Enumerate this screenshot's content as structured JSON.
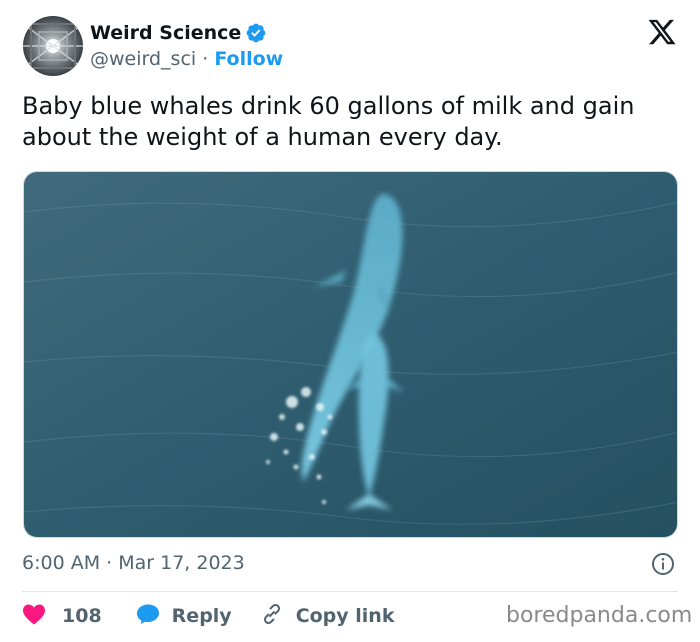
{
  "author": {
    "display_name": "Weird Science",
    "handle": "@weird_sci",
    "separator": "·",
    "follow_label": "Follow"
  },
  "tweet": {
    "text": "Baby blue whales drink 60 gallons of milk and gain about the weight of a human every day.",
    "timestamp": "6:00 AM · Mar 17, 2023"
  },
  "actions": {
    "like_count": "108",
    "reply_label": "Reply",
    "copy_link_label": "Copy link"
  },
  "watermark": "boredpanda.com",
  "icons": {
    "verified": "verified-badge-icon",
    "platform": "x-logo-icon",
    "info": "info-icon",
    "like": "heart-icon",
    "reply": "speech-bubble-icon",
    "copy": "link-icon"
  },
  "colors": {
    "accent": "#1d9bf0",
    "like": "#f91880",
    "text": "#0f1419",
    "muted": "#536471"
  }
}
